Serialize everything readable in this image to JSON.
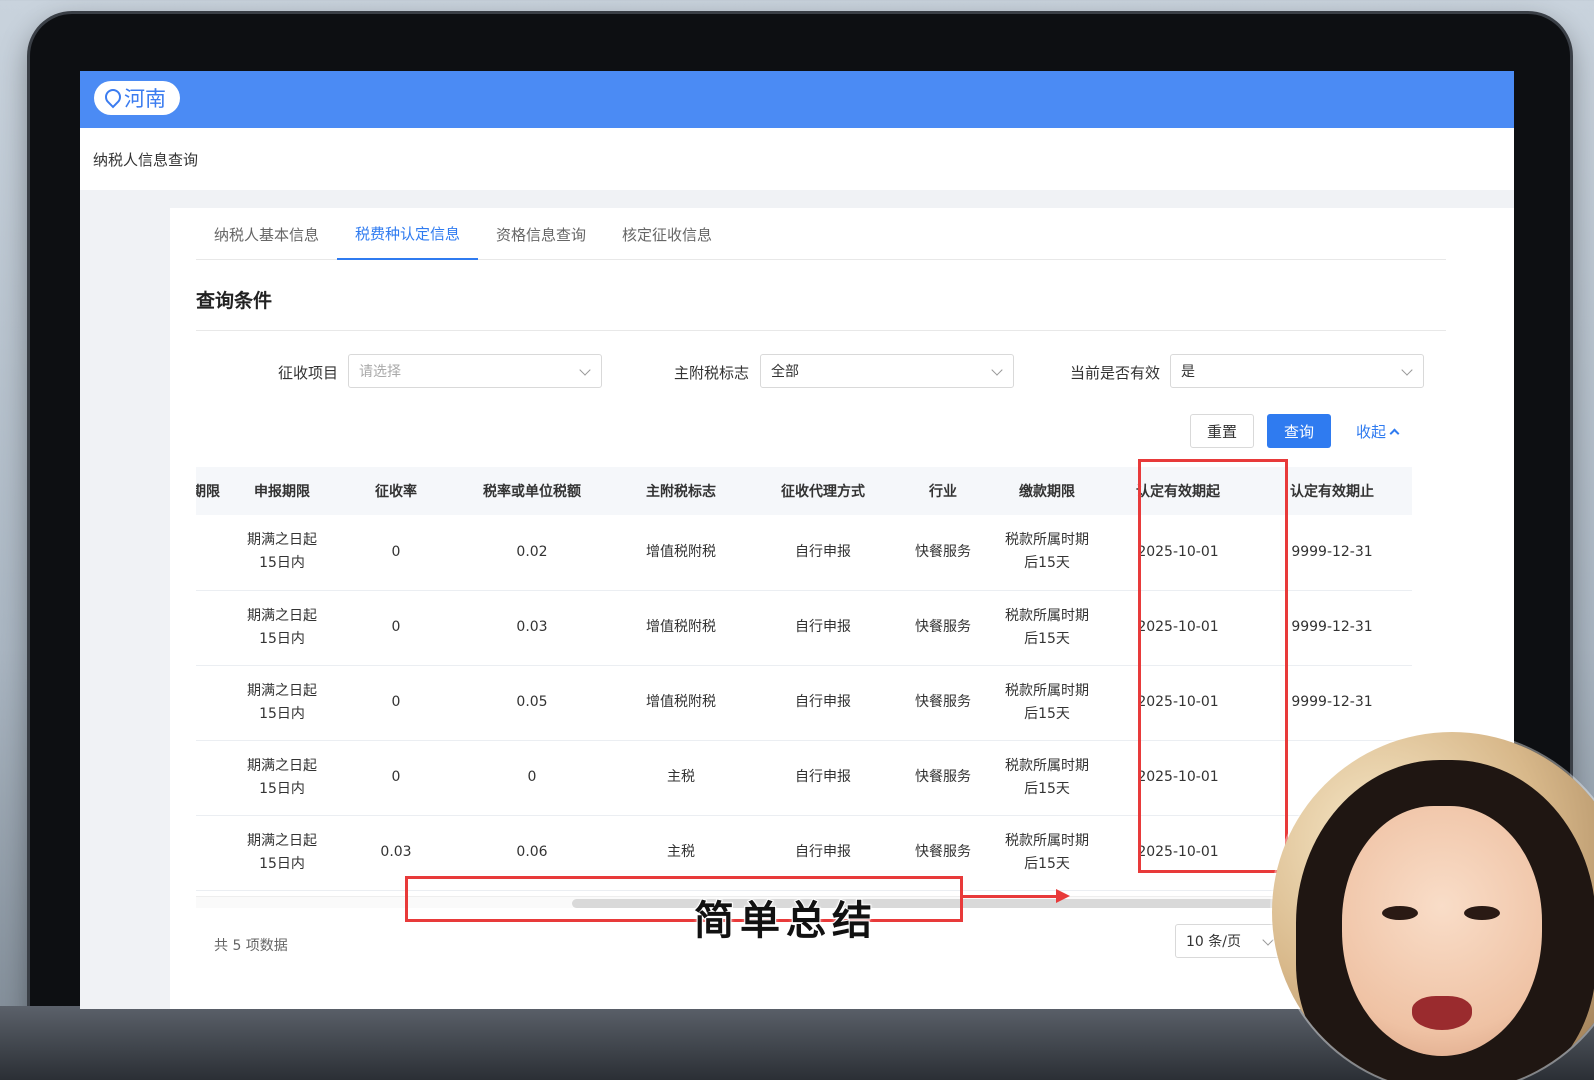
{
  "header": {
    "region": "河南"
  },
  "breadcrumb": {
    "title": "纳税人信息查询"
  },
  "tabs": [
    {
      "label": "纳税人基本信息"
    },
    {
      "label": "税费种认定信息"
    },
    {
      "label": "资格信息查询"
    },
    {
      "label": "核定征收信息"
    }
  ],
  "active_tab": "税费种认定信息",
  "query": {
    "section_title": "查询条件",
    "fields": {
      "levy_item": {
        "label": "征收项目",
        "placeholder": "请选择"
      },
      "main_sub_flag": {
        "label": "主附税标志",
        "value": "全部"
      },
      "is_valid": {
        "label": "当前是否有效",
        "value": "是"
      }
    },
    "reset_label": "重置",
    "search_label": "查询",
    "collapse_label": "收起"
  },
  "table": {
    "headers": [
      "期限",
      "申报期限",
      "征收率",
      "税率或单位税额",
      "主附税标志",
      "征收代理方式",
      "行业",
      "缴款期限",
      "认定有效期起",
      "认定有效期止"
    ],
    "rows": [
      {
        "c0": "",
        "c1a": "期满之日起",
        "c1b": "15日内",
        "c2": "0",
        "c3": "0.02",
        "c4": "增值税附税",
        "c5": "自行申报",
        "c6": "快餐服务",
        "c7a": "税款所属时期",
        "c7b": "后15天",
        "c8": "2025-10-01",
        "c9": "9999-12-31"
      },
      {
        "c0": "",
        "c1a": "期满之日起",
        "c1b": "15日内",
        "c2": "0",
        "c3": "0.03",
        "c4": "增值税附税",
        "c5": "自行申报",
        "c6": "快餐服务",
        "c7a": "税款所属时期",
        "c7b": "后15天",
        "c8": "2025-10-01",
        "c9": "9999-12-31"
      },
      {
        "c0": "",
        "c1a": "期满之日起",
        "c1b": "15日内",
        "c2": "0",
        "c3": "0.05",
        "c4": "增值税附税",
        "c5": "自行申报",
        "c6": "快餐服务",
        "c7a": "税款所属时期",
        "c7b": "后15天",
        "c8": "2025-10-01",
        "c9": "9999-12-31"
      },
      {
        "c0": "",
        "c1a": "期满之日起",
        "c1b": "15日内",
        "c2": "0",
        "c3": "0",
        "c4": "主税",
        "c5": "自行申报",
        "c6": "快餐服务",
        "c7a": "税款所属时期",
        "c7b": "后15天",
        "c8": "2025-10-01",
        "c9": ""
      },
      {
        "c0": "",
        "c1a": "期满之日起",
        "c1b": "15日内",
        "c2": "0.03",
        "c3": "0.06",
        "c4": "主税",
        "c5": "自行申报",
        "c6": "快餐服务",
        "c7a": "税款所属时期",
        "c7b": "后15天",
        "c8": "2025-10-01",
        "c9": ""
      }
    ]
  },
  "pagination": {
    "total": "共 5 项数据",
    "page_size": "10 条/页"
  },
  "overlay": {
    "subtitle": "简单总结"
  },
  "colors": {
    "primary": "#2f7bf0",
    "topbar": "#4b8bf4",
    "annotation": "#e83a3a"
  }
}
